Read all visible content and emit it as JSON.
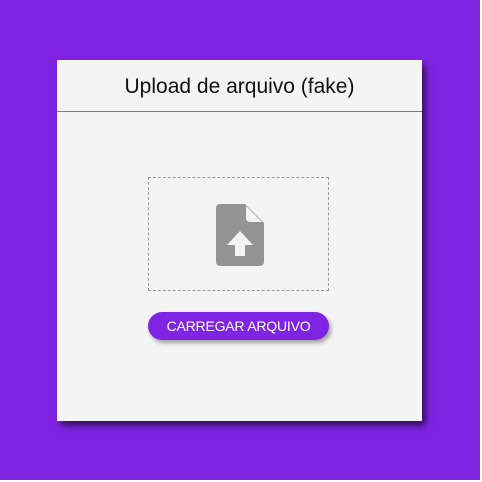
{
  "page": {
    "background_color": "#8024e3"
  },
  "card": {
    "title": "Upload de arquivo (fake)",
    "background_color": "#f4f4f4"
  },
  "dropzone": {
    "icon": "file-upload-icon"
  },
  "upload_button": {
    "label": "CARREGAR ARQUIVO",
    "color": "#8024e3"
  }
}
